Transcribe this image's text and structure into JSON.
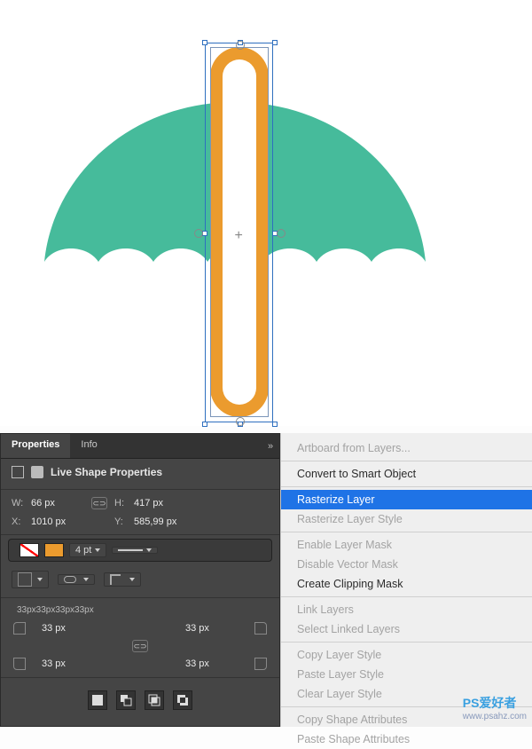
{
  "canvas": {
    "canopy_color": "#46bb9b",
    "stick_color": "#eb9b2e"
  },
  "props": {
    "tab_properties": "Properties",
    "tab_info": "Info",
    "subhead": "Live Shape Properties",
    "w_label": "W:",
    "w_value": "66 px",
    "h_label": "H:",
    "h_value": "417 px",
    "x_label": "X:",
    "x_value": "1010 px",
    "y_label": "Y:",
    "y_value": "585,99 px",
    "stroke_width": "4 pt",
    "radius_summary": "33px33px33px33px",
    "r_tl": "33 px",
    "r_tr": "33 px",
    "r_bl": "33 px",
    "r_br": "33 px"
  },
  "ctx": {
    "items": [
      {
        "label": "Artboard from Layers...",
        "state": "disabled"
      },
      {
        "sep": true
      },
      {
        "label": "Convert to Smart Object",
        "state": "enabled"
      },
      {
        "sep": true
      },
      {
        "label": "Rasterize Layer",
        "state": "selected"
      },
      {
        "label": "Rasterize Layer Style",
        "state": "disabled"
      },
      {
        "sep": true
      },
      {
        "label": "Enable Layer Mask",
        "state": "disabled"
      },
      {
        "label": "Disable Vector Mask",
        "state": "disabled"
      },
      {
        "label": "Create Clipping Mask",
        "state": "enabled"
      },
      {
        "sep": true
      },
      {
        "label": "Link Layers",
        "state": "disabled"
      },
      {
        "label": "Select Linked Layers",
        "state": "disabled"
      },
      {
        "sep": true
      },
      {
        "label": "Copy Layer Style",
        "state": "disabled"
      },
      {
        "label": "Paste Layer Style",
        "state": "disabled"
      },
      {
        "label": "Clear Layer Style",
        "state": "disabled"
      },
      {
        "sep": true
      },
      {
        "label": "Copy Shape Attributes",
        "state": "disabled"
      },
      {
        "label": "Paste Shape Attributes",
        "state": "disabled"
      }
    ]
  },
  "watermark": {
    "brand": "PS爱好者",
    "url": "www.psahz.com"
  }
}
